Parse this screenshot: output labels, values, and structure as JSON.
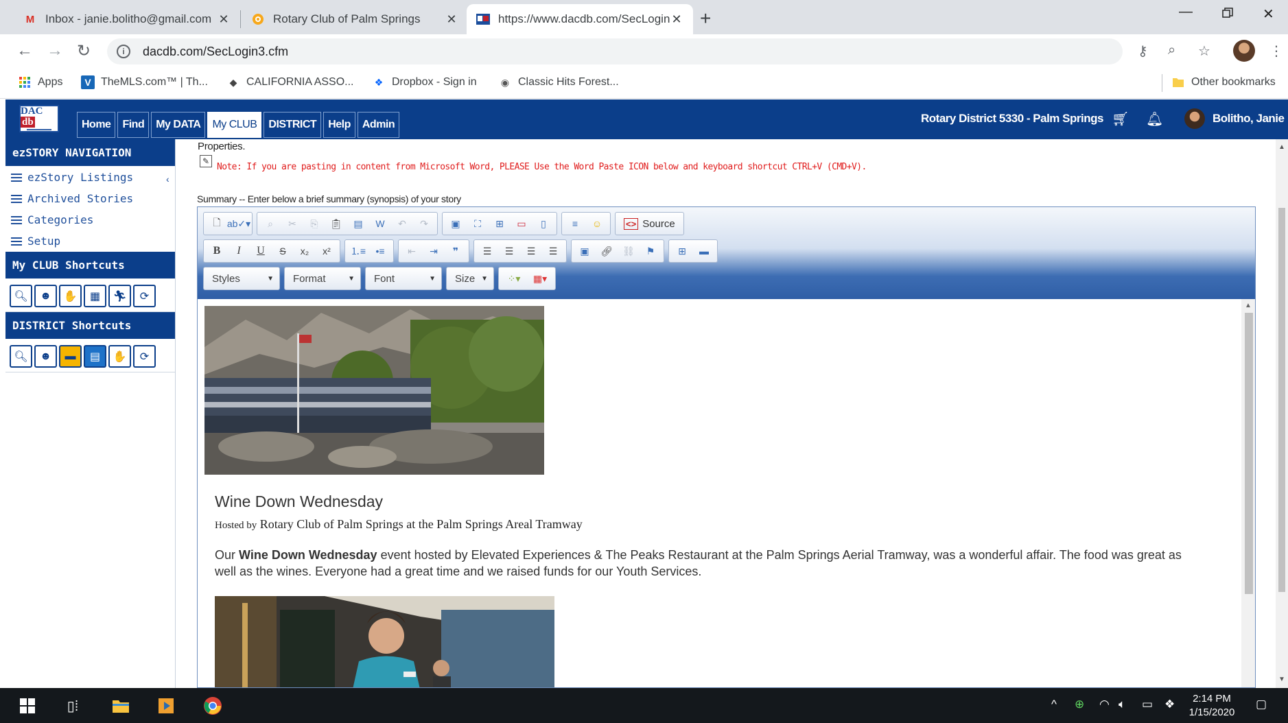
{
  "browser": {
    "tabs": [
      {
        "title": "Inbox - janie.bolitho@gmail.com",
        "icon": "gmail-icon"
      },
      {
        "title": "Rotary Club of Palm Springs",
        "icon": "rotary-icon"
      },
      {
        "title": "https://www.dacdb.com/SecLogin",
        "icon": "dacdb-icon"
      }
    ],
    "url": "dacdb.com/SecLogin3.cfm",
    "bookmarks": [
      "Apps",
      "TheMLS.com™ | Th...",
      "CALIFORNIA ASSO...",
      "Dropbox - Sign in",
      "Classic Hits Forest..."
    ],
    "other_bookmarks": "Other bookmarks"
  },
  "app": {
    "logo_text": "DAC db",
    "nav": [
      "Home",
      "Find",
      "My DATA",
      "My CLUB",
      "DISTRICT",
      "Help",
      "Admin"
    ],
    "district": "Rotary District 5330 - Palm Springs",
    "user": "Bolitho, Janie"
  },
  "sidebar": {
    "nav_title": "ezSTORY NAVIGATION",
    "items": [
      "ezStory Listings",
      "Archived Stories",
      "Categories",
      "Setup"
    ],
    "club_title": "My CLUB Shortcuts",
    "district_title": "DISTRICT Shortcuts"
  },
  "editor": {
    "properties_label": "Properties.",
    "note": "Note: If you are pasting in content from Microsoft Word, PLEASE Use the Word Paste ICON below and keyboard shortcut CTRL+V (CMD+V).",
    "summary_label": "Summary -- Enter below a brief summary (synopsis) of your story",
    "source_label": "Source",
    "combos": [
      "Styles",
      "Format",
      "Font",
      "Size"
    ]
  },
  "story": {
    "title": "Wine Down Wednesday",
    "hosted_prefix": "Hosted by",
    "hosted_rest": "Rotary Club of Palm Springs at the Palm Springs Areal Tramway",
    "body_prefix": "Our",
    "body_bold": "Wine Down Wednesday",
    "body_rest": "event hosted by Elevated Experiences & The Peaks Restaurant at the Palm Springs Aerial Tramway, was a wonderful affair. The food was great as well as the wines. Everyone had a great time and we raised funds for our Youth Services."
  },
  "taskbar": {
    "time": "2:14 PM",
    "date": "1/15/2020"
  },
  "colors": {
    "app_header": "#0b3e8a",
    "note_red": "#e01b1b",
    "taskbar": "#14181c"
  }
}
